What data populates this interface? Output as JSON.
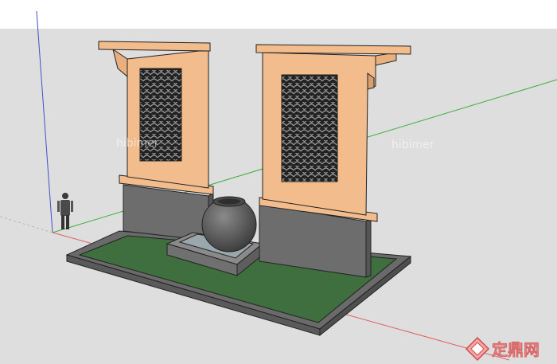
{
  "watermarks": {
    "left": "hibimer",
    "right": "hibimer",
    "corner_brand": "定鼎网"
  },
  "icons": {
    "corner_logo": "diamond-logo-icon"
  },
  "colors": {
    "wall": "#f2bc8c",
    "wall_edge": "#c98f5e",
    "base": "#6f6f6f",
    "lawn": "#3f6e3f",
    "axis_red": "#e06060",
    "axis_green": "#3cae3c",
    "axis_blue": "#4050c8"
  }
}
